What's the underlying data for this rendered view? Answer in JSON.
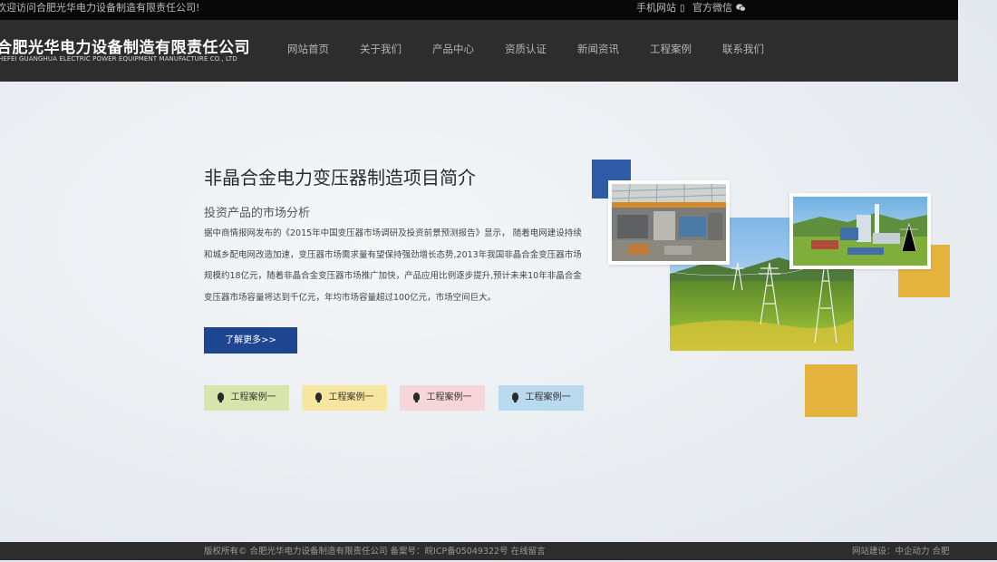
{
  "topbar": {
    "welcome": "欢迎访问合肥光华电力设备制造有限责任公司!",
    "mobile_site": "手机网站",
    "official_wechat": "官方微信"
  },
  "header": {
    "company_name_cn": "合肥光华电力设备制造有限责任公司",
    "company_name_en": "HEFEI GUANGHUA ELECTRIC POWER EQUIPMENT MANUFACTURE CO., LTD"
  },
  "nav": {
    "items": [
      {
        "label": "网站首页"
      },
      {
        "label": "关于我们"
      },
      {
        "label": "产品中心"
      },
      {
        "label": "资质认证"
      },
      {
        "label": "新闻资讯"
      },
      {
        "label": "工程案例"
      },
      {
        "label": "联系我们"
      }
    ]
  },
  "intro": {
    "title": "非晶合金电力变压器制造项目简介",
    "subtitle": "投资产品的市场分析",
    "body": "据中商情报网发布的《2015年中国变压器市场调研及投资前景预测报告》显示， 随着电网建设持续和城乡配电网改造加速，变压器市场需求量有望保持强劲增长态势,2013年我国非晶合金变压器市场规模约18亿元，随着非晶合金变压器市场推广加快，产品应用比例逐步提升,预计未来10年非晶合金变压器市场容量将达到千亿元，年均市场容量超过100亿元，市场空间巨大。",
    "more_button": "了解更多>>"
  },
  "cases": [
    {
      "label": "工程案例一"
    },
    {
      "label": "工程案例一"
    },
    {
      "label": "工程案例一"
    },
    {
      "label": "工程案例一"
    }
  ],
  "footer": {
    "copyright": "版权所有© 合肥光华电力设备制造有限责任公司 备案号：皖ICP备05049322号 在线留言",
    "builder": "网站建设：中企动力 合肥"
  },
  "colors": {
    "accent_blue": "#1e4690",
    "square_blue": "#2f5aa5",
    "square_yellow": "#e3b33d",
    "case_green": "#d9e4ad",
    "case_yellow": "#f7e6a0",
    "case_pink": "#f7d6d9",
    "case_blue": "#b8d9ee"
  }
}
